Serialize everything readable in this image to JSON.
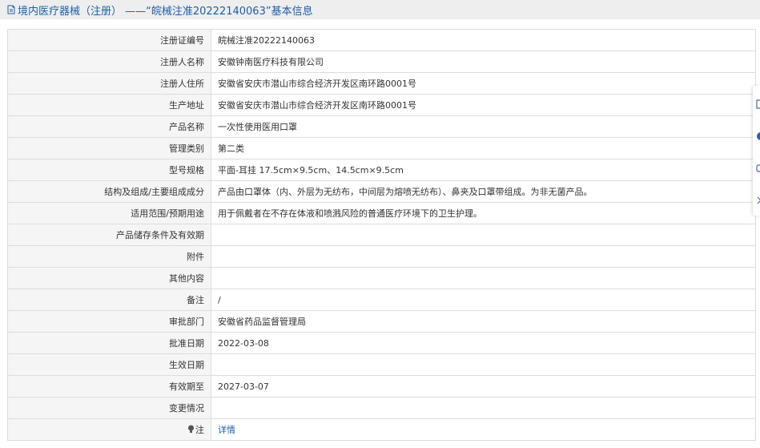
{
  "header": {
    "title": "境内医疗器械（注册） ——“皖械注准20222140063”基本信息",
    "icon": "document-icon",
    "color": "#1c5fa8"
  },
  "rows": [
    {
      "label": "注册证编号",
      "value": "皖械注准20222140063"
    },
    {
      "label": "注册人名称",
      "value": "安徽钟南医疗科技有限公司"
    },
    {
      "label": "注册人住所",
      "value": "安徽省安庆市潜山市综合经济开发区南环路0001号"
    },
    {
      "label": "生产地址",
      "value": "安徽省安庆市潜山市综合经济开发区南环路0001号"
    },
    {
      "label": "产品名称",
      "value": "一次性使用医用口罩"
    },
    {
      "label": "管理类别",
      "value": "第二类"
    },
    {
      "label": "型号规格",
      "value": "平面-耳挂 17.5cm×9.5cm、14.5cm×9.5cm"
    },
    {
      "label": "结构及组成/主要组成成分",
      "value": "产品由口罩体（内、外层为无纺布，中间层为熔喷无纺布）、鼻夹及口罩带组成。为非无菌产品。"
    },
    {
      "label": "适用范围/预期用途",
      "value": "用于佩戴者在不存在体液和喷溅风险的普通医疗环境下的卫生护理。"
    },
    {
      "label": "产品储存条件及有效期",
      "value": ""
    },
    {
      "label": "附件",
      "value": ""
    },
    {
      "label": "其他内容",
      "value": ""
    },
    {
      "label": "备注",
      "value": "/"
    },
    {
      "label": "审批部门",
      "value": "安徽省药品监督管理局"
    },
    {
      "label": "批准日期",
      "value": "2022-03-08"
    },
    {
      "label": "生效日期",
      "value": ""
    },
    {
      "label": "有效期至",
      "value": "2027-03-07"
    },
    {
      "label": "变更情况",
      "value": ""
    }
  ],
  "note_row": {
    "label": "注",
    "link": "详情",
    "icon": "lightbulb-icon"
  },
  "side_toolbar": {
    "icons": [
      "copy-icon",
      "circle-icon",
      "link-icon",
      "close-icon"
    ]
  }
}
